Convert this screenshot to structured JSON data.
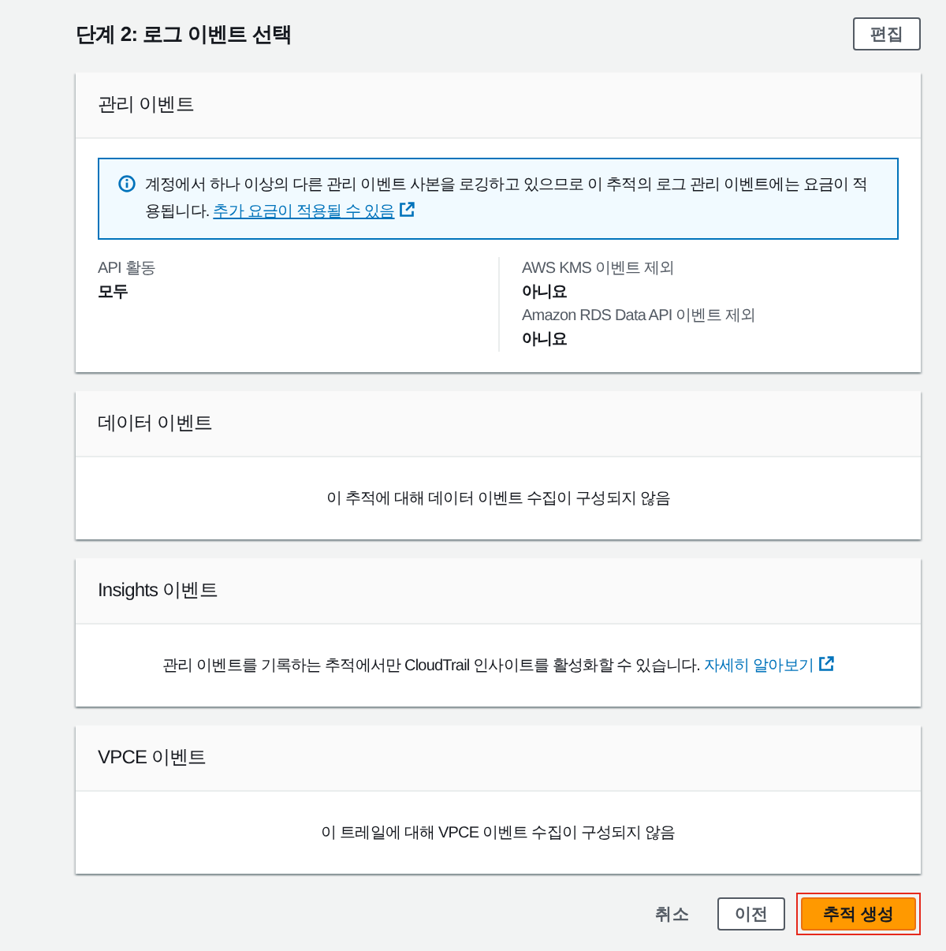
{
  "step": {
    "title": "단계 2: 로그 이벤트 선택",
    "edit_button": "편집"
  },
  "sections": [
    {
      "kind": "details",
      "title": "관리 이벤트",
      "alert": {
        "text": "계정에서 하나 이상의 다른 관리 이벤트 사본을 로깅하고 있으므로 이 추적의 로그 관리 이벤트에는 요금이 적용됩니다.",
        "link": "추가 요금이 적용될 수 있음"
      },
      "columns": [
        {
          "items": [
            {
              "label": "API 활동",
              "value": "모두"
            }
          ]
        },
        {
          "items": [
            {
              "label": "AWS KMS 이벤트 제외",
              "value": "아니요"
            },
            {
              "label": "Amazon RDS Data API 이벤트 제외",
              "value": "아니요"
            }
          ]
        }
      ]
    },
    {
      "kind": "message",
      "title": "데이터 이벤트",
      "message": "이 추적에 대해 데이터 이벤트 수집이 구성되지 않음"
    },
    {
      "kind": "message",
      "title": "Insights 이벤트",
      "message": "관리 이벤트를 기록하는 추적에서만 CloudTrail 인사이트를 활성화할 수 있습니다.",
      "link": "자세히 알아보기"
    },
    {
      "kind": "message",
      "title": "VPCE 이벤트",
      "message": "이 트레일에 대해 VPCE 이벤트 수집이 구성되지 않음"
    }
  ],
  "actions": [
    {
      "kind": "link",
      "label": "취소",
      "highlighted": false
    },
    {
      "kind": "secondary",
      "label": "이전",
      "highlighted": false
    },
    {
      "kind": "primary",
      "label": "추적 생성",
      "highlighted": true
    }
  ]
}
